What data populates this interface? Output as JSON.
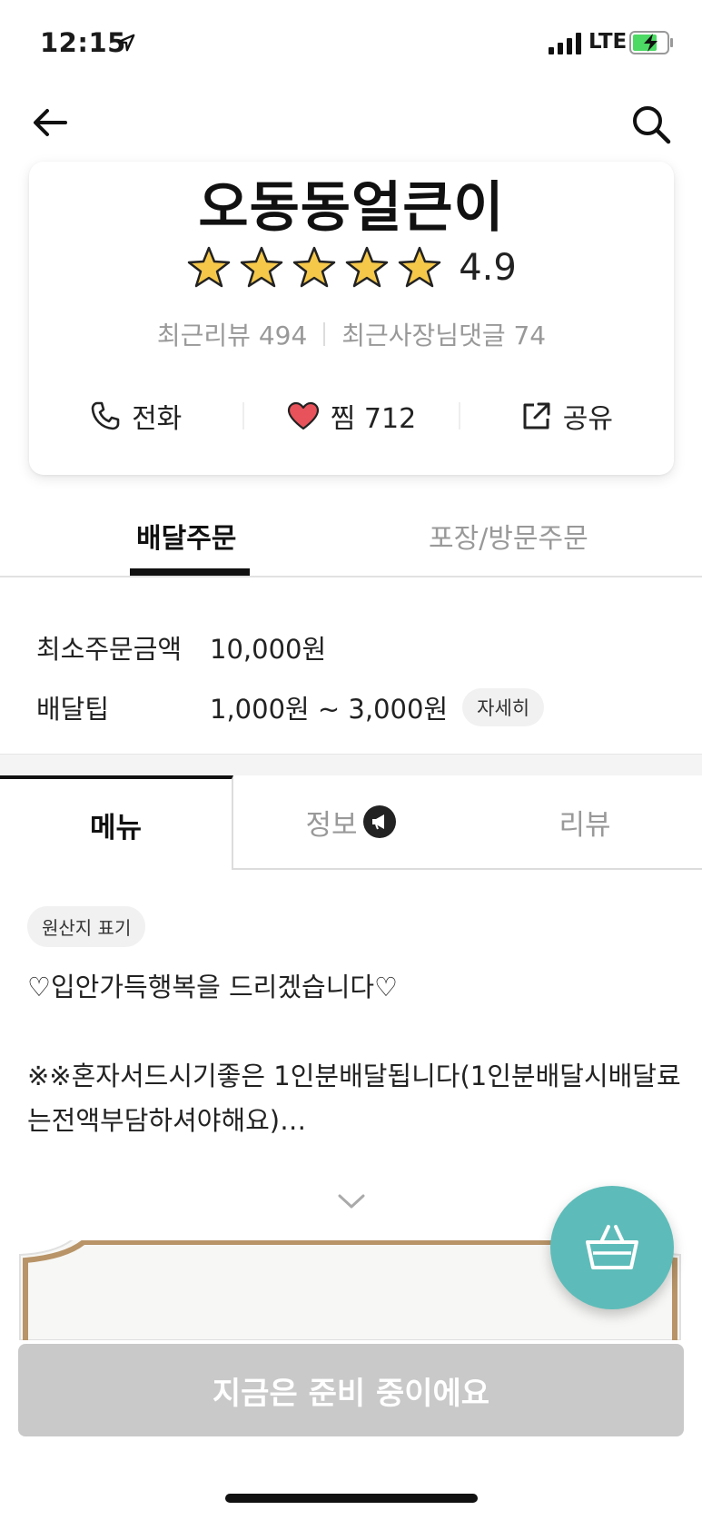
{
  "status_bar": {
    "time": "12:15",
    "network": "LTE"
  },
  "store": {
    "name": "오동동얼큰이",
    "rating": "4.9",
    "rating_stars": 5,
    "recent_reviews": "최근리뷰 494",
    "recent_owner_replies": "최근사장님댓글 74",
    "call_label": "전화",
    "like_label": "찜 712",
    "share_label": "공유"
  },
  "order_tabs": {
    "delivery": "배달주문",
    "pickup": "포장/방문주문"
  },
  "delivery_info": {
    "min_order_label": "최소주문금액",
    "min_order_value": "10,000원",
    "tip_label": "배달팁",
    "tip_value": "1,000원 ~ 3,000원",
    "detail_label": "자세히"
  },
  "content_tabs": {
    "menu": "메뉴",
    "info": "정보",
    "review": "리뷰"
  },
  "notice": {
    "origin_label": "원산지 표기",
    "text": "♡입안가득행복을 드리겠습니다♡\n\n※※혼자서드시기좋은 1인분배달됩니다(1인분배달시배달료는전액부담하셔야해요)…"
  },
  "bottom": {
    "status_button": "지금은 준비 중이에요"
  },
  "colors": {
    "accent_teal": "#5dbcb9",
    "star": "#f6c84a",
    "heart": "#e8525a",
    "disabled": "#c9c9c9"
  },
  "icons": [
    "location-arrow-icon",
    "signal-icon",
    "battery-charging-icon",
    "back-arrow-icon",
    "search-icon",
    "star-icon",
    "phone-icon",
    "heart-icon",
    "share-icon",
    "megaphone-icon",
    "chevron-down-icon",
    "basket-icon"
  ]
}
